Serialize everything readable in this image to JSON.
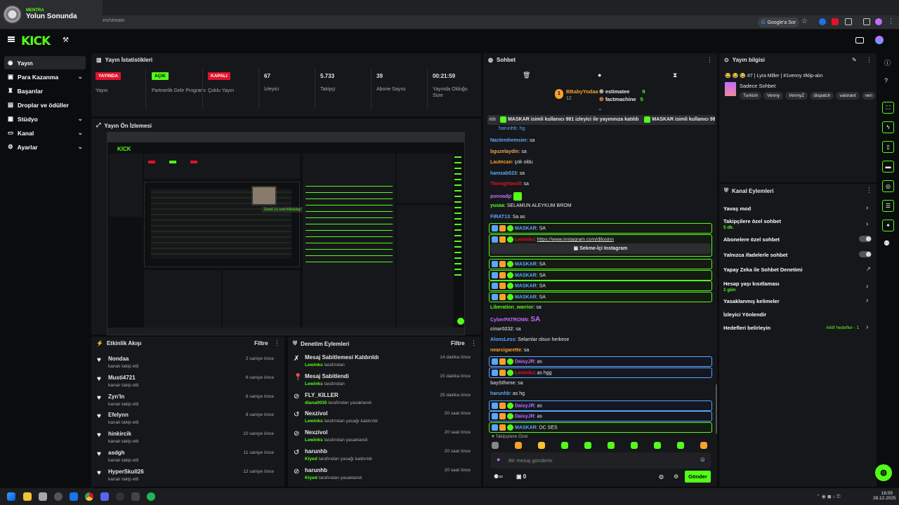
{
  "browser": {
    "tab_channel": "MENTRA",
    "tab_title": "Yolun Sonunda",
    "url": "dashboard.kick.com/stream",
    "google_btn": "Google'a Sor"
  },
  "brand": {
    "logo": "KICK",
    "accent": "#53fc18"
  },
  "sidebar": {
    "items": [
      {
        "label": "Yayın",
        "icon": "live-icon"
      },
      {
        "label": "Para Kazanma",
        "icon": "money-icon"
      },
      {
        "label": "Başarılar",
        "icon": "trophy-icon"
      },
      {
        "label": "Droplar ve ödüller",
        "icon": "gift-icon"
      },
      {
        "label": "Stüdyo",
        "icon": "studio-icon"
      },
      {
        "label": "Kanal",
        "icon": "channel-icon"
      },
      {
        "label": "Ayarlar",
        "icon": "gear-icon"
      }
    ]
  },
  "stats": {
    "title": "Yayın İstatistikleri",
    "items": [
      {
        "badge": "YAYINDA",
        "label": "Yayın",
        "color": "#e1122c"
      },
      {
        "badge": "AÇIK",
        "label": "Partnerlik Gelir Programı",
        "color": "#53fc18"
      },
      {
        "badge": "KAPALI",
        "label": "Çoklu Yayın",
        "color": "#e1122c"
      },
      {
        "value": "67",
        "label": "İzleyici"
      },
      {
        "value": "5.733",
        "label": "Takipçi"
      },
      {
        "value": "39",
        "label": "Abone Sayısı"
      },
      {
        "value": "00:21:59",
        "label": "Yayında Olduğu Süre"
      }
    ]
  },
  "preview": {
    "title": "Yayın Ön İzlemesi"
  },
  "feed": {
    "title": "Etkinlik Akışı",
    "filter": "Filtre",
    "rows": [
      {
        "name": "Nondaa",
        "sub": "kanalı takip etti",
        "time": "2 saniye önce"
      },
      {
        "name": "Musti4721",
        "sub": "kanalı takip etti",
        "time": "6 saniye önce"
      },
      {
        "name": "Zyn'In",
        "sub": "kanalı takip etti",
        "time": "6 saniye önce"
      },
      {
        "name": "Efelynn",
        "sub": "kanalı takip etti",
        "time": "8 saniye önce"
      },
      {
        "name": "hinkircik",
        "sub": "kanalı takip etti",
        "time": "10 saniye önce"
      },
      {
        "name": "asdgh",
        "sub": "kanalı takip etti",
        "time": "11 saniye önce"
      },
      {
        "name": "HyperSkull26",
        "sub": "kanalı takip etti",
        "time": "12 saniye önce"
      }
    ]
  },
  "mod": {
    "title": "Denetim Eylemleri",
    "filter": "Filtre",
    "rows": [
      {
        "icon": "unpin-icon",
        "title": "Mesaj Sabitlemesi Kaldırıldı",
        "user": "Lewinks",
        "suffix": "tarafından",
        "time": "14 dakika önce"
      },
      {
        "icon": "pin-icon",
        "title": "Mesaj Sabitlendi",
        "user": "Lewinks",
        "suffix": "tarafından",
        "time": "15 dakika önce"
      },
      {
        "icon": "ban-icon",
        "title": "FLY_KILLER",
        "user": "diana0035",
        "suffix": "tarafından yasaklandı",
        "time": "25 dakika önce"
      },
      {
        "icon": "unban-icon",
        "title": "Nexzivol",
        "user": "Lewinks",
        "suffix": "tarafından yasağı kaldırıldı",
        "time": "20 saat önce"
      },
      {
        "icon": "ban-icon",
        "title": "Nexzivol",
        "user": "Lewinks",
        "suffix": "tarafından yasaklandı",
        "time": "20 saat önce"
      },
      {
        "icon": "unban-icon",
        "title": "harunhb",
        "user": "Klyed",
        "suffix": "tarafından yasağı kaldırıldı",
        "time": "20 saat önce"
      },
      {
        "icon": "ban-icon",
        "title": "harunhb",
        "user": "Klyed",
        "suffix": "tarafından yasaklandı",
        "time": "20 saat önce"
      }
    ]
  },
  "chat": {
    "title": "Sohbet",
    "top": [
      {
        "name": "BBabyYodaa",
        "count": "12"
      },
      {
        "name": "estimatee",
        "count": "9"
      },
      {
        "name": "factmachine",
        "count": "5"
      }
    ],
    "ticker": "MASKAR isimli kullanıcı 981 izleyici ile yayınınıza katıldı",
    "ticker_prefix": "ıldı",
    "messages": [
      {
        "user": "Nactemhemsier",
        "color": "#5aa6ff",
        "text": "sa"
      },
      {
        "user": "bguzelaydin",
        "color": "#f0a050",
        "text": "sa"
      },
      {
        "user": "Lautecan",
        "color": "#f7a12c",
        "text": "çok oldu"
      },
      {
        "user": "hamzab523",
        "color": "#5aa6ff",
        "text": "sa"
      },
      {
        "user": "Thenightwolf",
        "color": "#e1122c",
        "text": "sa"
      },
      {
        "user": "ponoadp",
        "color": "#c56bff",
        "text": ""
      },
      {
        "user": "yusaa",
        "color": "#53fc18",
        "text": "SELAMUN ALEYKUM BROM"
      },
      {
        "user": "FIRAT13",
        "color": "#5aa6ff",
        "text": "Sa as"
      },
      {
        "user": "MASKAR",
        "color": "#5aa6ff",
        "text": "SA",
        "hl": true
      },
      {
        "user": "Lewinks",
        "color": "#e1122c",
        "text": "https://www.instagram.com/dilosinn",
        "hl": true
      },
      {
        "user": "MASKAR",
        "color": "#5aa6ff",
        "text": "SA",
        "hl": true
      },
      {
        "user": "MASKAR",
        "color": "#5aa6ff",
        "text": "SA",
        "hl": true
      },
      {
        "user": "MASKAR",
        "color": "#5aa6ff",
        "text": "SA",
        "hl": true
      },
      {
        "user": "MASKAR",
        "color": "#5aa6ff",
        "text": "SA",
        "hl": true
      },
      {
        "user": "Liberation_warrior",
        "color": "#53fc18",
        "text": "sa"
      },
      {
        "user": "CyberPATRONN",
        "color": "#c56bff",
        "text": "SA"
      },
      {
        "user": "cinar0232",
        "color": "#bbbbbb",
        "text": "sa"
      },
      {
        "user": "AlonsLess",
        "color": "#5aa6ff",
        "text": "Selamlar olsun herkese"
      },
      {
        "user": "nearcigarette",
        "color": "#f7a12c",
        "text": "sa"
      },
      {
        "user": "DaisyJR",
        "color": "#c56bff",
        "text": "as",
        "hl2": true
      },
      {
        "user": "Lewinks",
        "color": "#e1122c",
        "text": "as hgg",
        "hl2": true
      },
      {
        "user": "baySthene",
        "color": "#bbbbbb",
        "text": "sa"
      },
      {
        "user": "harunhb",
        "color": "#5aa6ff",
        "text": "as hg"
      },
      {
        "user": "DaisyJR",
        "color": "#c56bff",
        "text": "as",
        "hl2": true
      },
      {
        "user": "DaisyJR",
        "color": "#c56bff",
        "text": "as",
        "hl2": true
      },
      {
        "user": "MASKAR",
        "color": "#5aa6ff",
        "text": "DC SES",
        "hl": true
      }
    ],
    "link_button": "Sekme-İçi Instagram",
    "mode_label": "Takipçilere Özel",
    "input_placeholder": "Bir mesaj gönderin",
    "points": "0",
    "send": "Gönder"
  },
  "info": {
    "title": "Yayın bilgisi",
    "stream_title": "😂 😂 😂 #7 | Lyra Miller | #1venny #klip-alın",
    "category": "Sadece Sohbet",
    "tags": [
      "Turkish",
      "Venny",
      "VennyZ",
      "dispatch",
      "valorant",
      "ven"
    ]
  },
  "actions": {
    "title": "Kanal Eylemleri",
    "items": [
      {
        "label": "Yavaş mod",
        "type": "arrow"
      },
      {
        "label": "Takipçilere özel sohbet",
        "sub": "5 dk.",
        "type": "arrow"
      },
      {
        "label": "Abonelere özel sohbet",
        "type": "toggle"
      },
      {
        "label": "Yalnızca ifadelerle sohbet",
        "type": "toggle"
      },
      {
        "label": "Yapay Zeka ile Sohbet Denetimi",
        "type": "external"
      },
      {
        "label": "Hesap yaşı kısıtlaması",
        "sub": "1 gün",
        "type": "arrow"
      },
      {
        "label": "Yasaklanmış kelimeler",
        "type": "arrow"
      },
      {
        "label": "İzleyici Yönlendir",
        "type": "none"
      },
      {
        "label": "Hedefleri belirleyin",
        "extra": "Aktif hedefler - 1",
        "type": "arrow"
      }
    ]
  },
  "taskbar": {
    "time": "18:05",
    "date": "28.12.2025"
  }
}
